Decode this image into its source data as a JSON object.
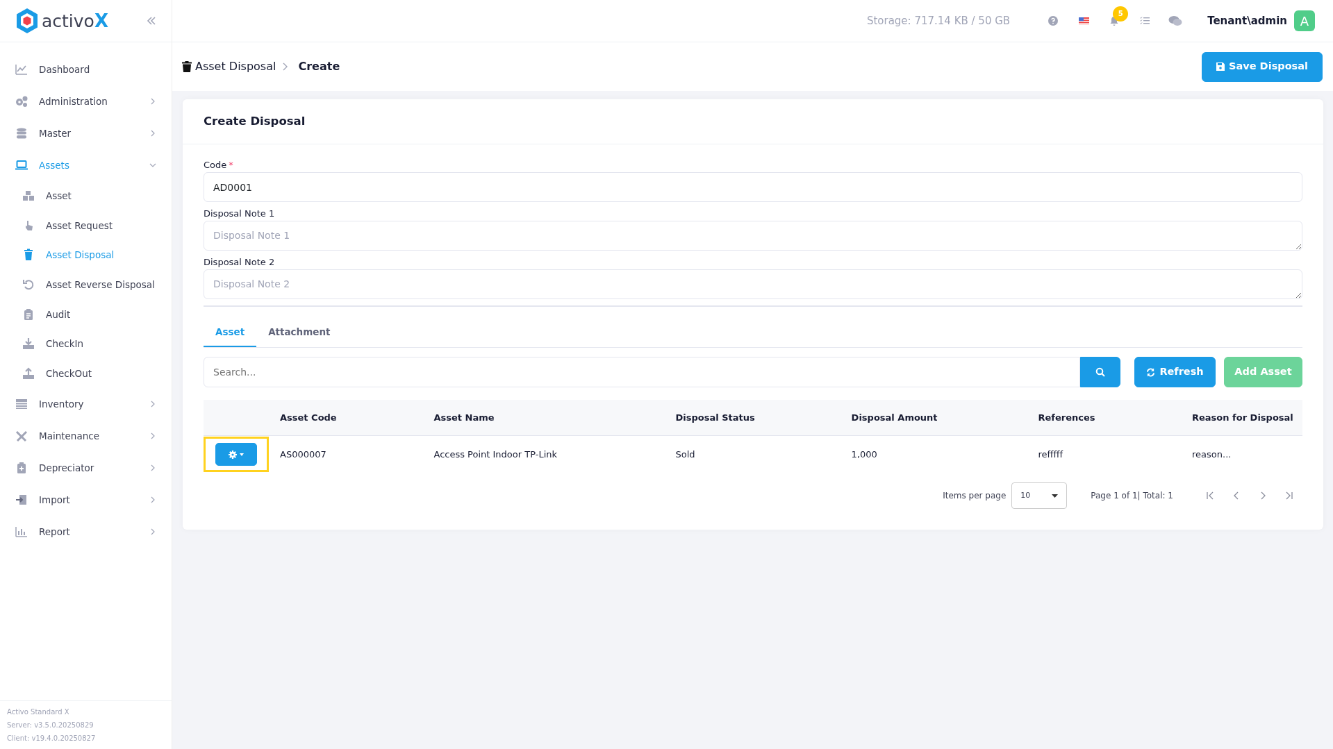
{
  "sidebar": {
    "logo": {
      "name": "activo",
      "mark": "X"
    },
    "items": [
      {
        "label": "Dashboard",
        "selected": false
      },
      {
        "label": "Administration",
        "expanded": false,
        "selected": false
      },
      {
        "label": "Master",
        "expanded": false,
        "selected": false
      },
      {
        "label": "Assets",
        "expanded": true,
        "selected": true,
        "children": [
          {
            "label": "Asset",
            "selected": false
          },
          {
            "label": "Asset Request",
            "selected": false
          },
          {
            "label": "Asset Disposal",
            "selected": true
          },
          {
            "label": "Asset Reverse Disposal",
            "selected": false
          },
          {
            "label": "Audit",
            "selected": false
          },
          {
            "label": "CheckIn",
            "selected": false
          },
          {
            "label": "CheckOut",
            "selected": false
          }
        ]
      },
      {
        "label": "Inventory",
        "expanded": false,
        "selected": false
      },
      {
        "label": "Maintenance",
        "expanded": false,
        "selected": false
      },
      {
        "label": "Depreciator",
        "expanded": false,
        "selected": false
      },
      {
        "label": "Import",
        "expanded": false,
        "selected": false
      },
      {
        "label": "Report",
        "expanded": false,
        "selected": false
      }
    ],
    "footer": [
      "Activo Standard X",
      "Server: v3.5.0.20250829",
      "Client: v19.4.0.20250827"
    ]
  },
  "topbar": {
    "storage": "Storage: 717.14 KB / 50 GB",
    "notification_count": "5",
    "user": "Tenant\\admin",
    "avatar": "A"
  },
  "breadcrumb": [
    "Asset Disposal",
    "Create"
  ],
  "save_button": "Save Disposal",
  "form": {
    "title": "Create Disposal",
    "fields": [
      {
        "label": "Code",
        "required_mark": "*",
        "value": "AD0001",
        "kind": "input"
      },
      {
        "label": "Disposal Note 1",
        "placeholder": "Disposal Note 1",
        "kind": "textarea"
      },
      {
        "label": "Disposal Note 2",
        "placeholder": "Disposal Note 2",
        "kind": "textarea"
      }
    ]
  },
  "tabs": [
    {
      "label": "Asset",
      "selected": true
    },
    {
      "label": "Attachment",
      "selected": false
    }
  ],
  "search": {
    "placeholder": "Search..."
  },
  "buttons": {
    "refresh": "Refresh",
    "add": "Add Asset"
  },
  "table": {
    "columns": [
      "Asset Code",
      "Asset Name",
      "Disposal Status",
      "Disposal Amount",
      "References",
      "Reason for Disposal"
    ],
    "rows": [
      {
        "highlighted": true,
        "cells": [
          "AS000007",
          "Access Point Indoor TP-Link",
          "Sold",
          "1,000",
          "refffff",
          "reason..."
        ]
      }
    ]
  },
  "pagination": {
    "label": "Items per page",
    "page_size": "10",
    "summary": "Page 1 of 1| Total: 1"
  }
}
